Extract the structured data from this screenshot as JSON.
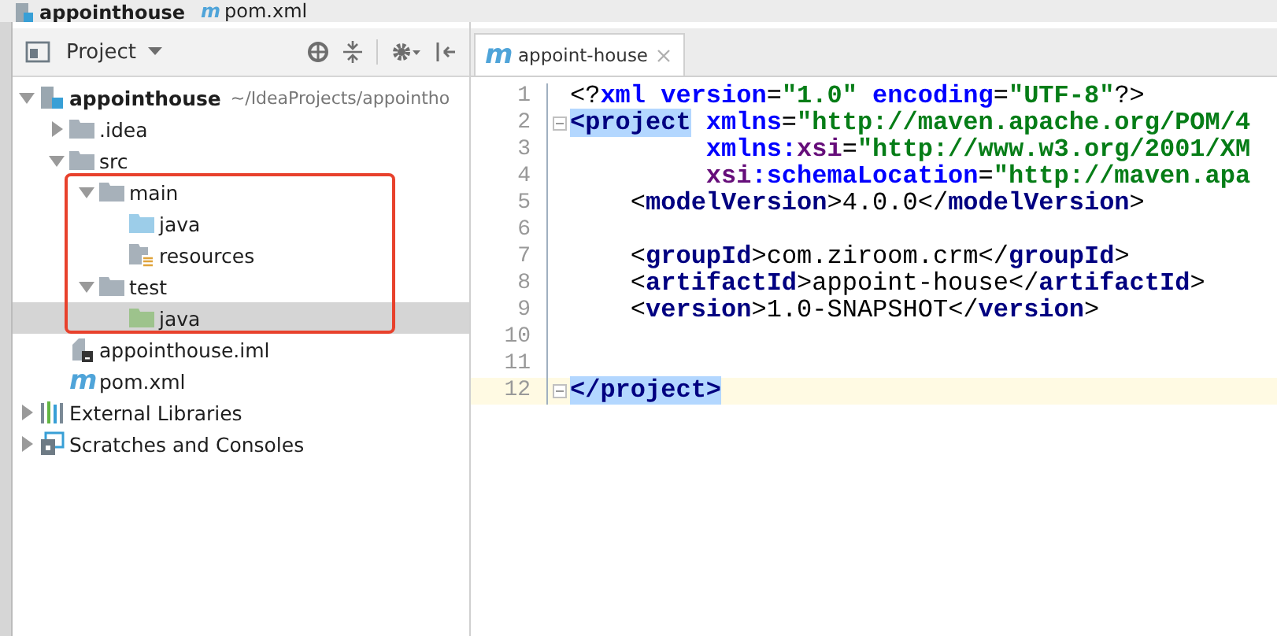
{
  "breadcrumb": [
    {
      "label": "appointhouse",
      "kind": "module"
    },
    {
      "label": "pom.xml",
      "kind": "maven",
      "icon": "m"
    }
  ],
  "project_panel": {
    "title": "Project"
  },
  "tree": [
    {
      "label": "appointhouse",
      "path": "~/IdeaProjects/appointho",
      "kind": "module",
      "expanded": true,
      "selected": false,
      "children": [
        {
          "label": ".idea",
          "kind": "folder",
          "expanded": false,
          "selected": false
        },
        {
          "label": "src",
          "kind": "folder",
          "expanded": true,
          "selected": false,
          "children": [
            {
              "label": "main",
              "kind": "folder",
              "expanded": true,
              "selected": false,
              "children": [
                {
                  "label": "java",
                  "kind": "source",
                  "selected": false
                },
                {
                  "label": "resources",
                  "kind": "resources",
                  "selected": false
                }
              ]
            },
            {
              "label": "test",
              "kind": "folder",
              "expanded": true,
              "selected": false,
              "children": [
                {
                  "label": "java",
                  "kind": "test",
                  "selected": true
                }
              ]
            }
          ]
        },
        {
          "label": "appointhouse.iml",
          "kind": "iml",
          "selected": false
        },
        {
          "label": "pom.xml",
          "kind": "maven",
          "icon": "m",
          "selected": false
        }
      ]
    },
    {
      "label": "External Libraries",
      "kind": "libraries",
      "expanded": false,
      "selected": false
    },
    {
      "label": "Scratches and Consoles",
      "kind": "scratches",
      "expanded": false,
      "selected": false
    }
  ],
  "editor_tabs": [
    {
      "label": "appoint-house",
      "icon": "m",
      "selected": true
    }
  ],
  "code": [
    {
      "number": "1",
      "kind": "top",
      "current": false,
      "segments": [
        {
          "kind": "punct",
          "text": "<?"
        },
        {
          "kind": "attr",
          "text": "xml "
        },
        {
          "kind": "attr",
          "text": "version"
        },
        {
          "kind": "punct",
          "text": "="
        },
        {
          "kind": "value",
          "text": "\"1.0\" "
        },
        {
          "kind": "attr",
          "text": "encoding"
        },
        {
          "kind": "punct",
          "text": "="
        },
        {
          "kind": "value",
          "text": "\"UTF-8\""
        },
        {
          "kind": "punct",
          "text": "?>"
        }
      ]
    },
    {
      "number": "2",
      "kind": "top",
      "current": false,
      "segments": [
        {
          "kind": "match",
          "text": "<project"
        },
        {
          "kind": "attr",
          "text": " xmlns"
        },
        {
          "kind": "punct",
          "text": "="
        },
        {
          "kind": "value",
          "text": "\"http://maven.apache.org/POM/4"
        }
      ]
    },
    {
      "number": "3",
      "kind": "attribute",
      "current": false,
      "segments": [
        {
          "kind": "attr",
          "text": "xmlns:"
        },
        {
          "kind": "ns",
          "text": "xsi"
        },
        {
          "kind": "punct",
          "text": "="
        },
        {
          "kind": "value",
          "text": "\"http://www.w3.org/2001/XM"
        }
      ]
    },
    {
      "number": "4",
      "kind": "attribute",
      "current": false,
      "segments": [
        {
          "kind": "ns",
          "text": "xsi"
        },
        {
          "kind": "attr",
          "text": ":schemaLocation"
        },
        {
          "kind": "punct",
          "text": "="
        },
        {
          "kind": "value",
          "text": "\"http://maven.apa"
        }
      ]
    },
    {
      "number": "5",
      "kind": "child",
      "current": false,
      "segments": [
        {
          "kind": "punct",
          "text": "<"
        },
        {
          "kind": "tag",
          "text": "modelVersion"
        },
        {
          "kind": "punct",
          "text": ">"
        },
        {
          "kind": "text",
          "text": "4.0.0"
        },
        {
          "kind": "punct",
          "text": "</"
        },
        {
          "kind": "tag",
          "text": "modelVersion"
        },
        {
          "kind": "punct",
          "text": ">"
        }
      ]
    },
    {
      "number": "6",
      "current": false
    },
    {
      "number": "7",
      "kind": "child",
      "current": false,
      "segments": [
        {
          "kind": "punct",
          "text": "<"
        },
        {
          "kind": "tag",
          "text": "groupId"
        },
        {
          "kind": "punct",
          "text": ">"
        },
        {
          "kind": "text",
          "text": "com.ziroom.crm"
        },
        {
          "kind": "punct",
          "text": "</"
        },
        {
          "kind": "tag",
          "text": "groupId"
        },
        {
          "kind": "punct",
          "text": ">"
        }
      ]
    },
    {
      "number": "8",
      "kind": "child",
      "current": false,
      "segments": [
        {
          "kind": "punct",
          "text": "<"
        },
        {
          "kind": "tag",
          "text": "artifactId"
        },
        {
          "kind": "punct",
          "text": ">"
        },
        {
          "kind": "text",
          "text": "appoint-house"
        },
        {
          "kind": "punct",
          "text": "</"
        },
        {
          "kind": "tag",
          "text": "artifactId"
        },
        {
          "kind": "punct",
          "text": ">"
        }
      ]
    },
    {
      "number": "9",
      "kind": "child",
      "current": false,
      "segments": [
        {
          "kind": "punct",
          "text": "<"
        },
        {
          "kind": "tag",
          "text": "version"
        },
        {
          "kind": "punct",
          "text": ">"
        },
        {
          "kind": "text",
          "text": "1.0-SNAPSHOT"
        },
        {
          "kind": "punct",
          "text": "</"
        },
        {
          "kind": "tag",
          "text": "version"
        },
        {
          "kind": "punct",
          "text": ">"
        }
      ]
    },
    {
      "number": "10",
      "current": false
    },
    {
      "number": "11",
      "current": false
    },
    {
      "number": "12",
      "kind": "top",
      "current": true,
      "segments": [
        {
          "kind": "match",
          "text": "</project>"
        }
      ]
    }
  ]
}
